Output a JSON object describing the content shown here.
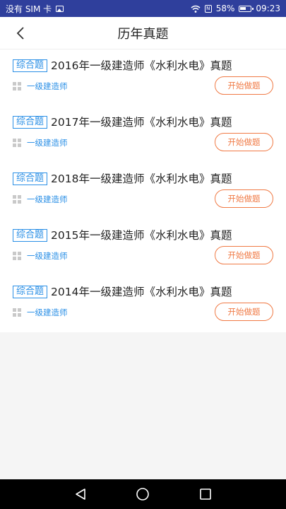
{
  "status_bar": {
    "carrier": "没有 SIM 卡",
    "battery_percent": "58%",
    "time": "09:23"
  },
  "header": {
    "title": "历年真题"
  },
  "items": [
    {
      "tag": "综合题",
      "title": "2016年一级建造师《水利水电》真题",
      "category": "一级建造师",
      "button": "开始做题"
    },
    {
      "tag": "综合题",
      "title": "2017年一级建造师《水利水电》真题",
      "category": "一级建造师",
      "button": "开始做题"
    },
    {
      "tag": "综合题",
      "title": "2018年一级建造师《水利水电》真题",
      "category": "一级建造师",
      "button": "开始做题"
    },
    {
      "tag": "综合题",
      "title": "2015年一级建造师《水利水电》真题",
      "category": "一级建造师",
      "button": "开始做题"
    },
    {
      "tag": "综合题",
      "title": "2014年一级建造师《水利水电》真题",
      "category": "一级建造师",
      "button": "开始做题"
    }
  ],
  "icons": {
    "back": "chevron-left-icon",
    "nav_back": "triangle-back-icon",
    "nav_home": "circle-home-icon",
    "nav_recent": "square-recent-icon"
  },
  "colors": {
    "status_bar": "#2f3f9c",
    "accent_blue": "#2a8fe6",
    "accent_orange": "#f07a45"
  }
}
